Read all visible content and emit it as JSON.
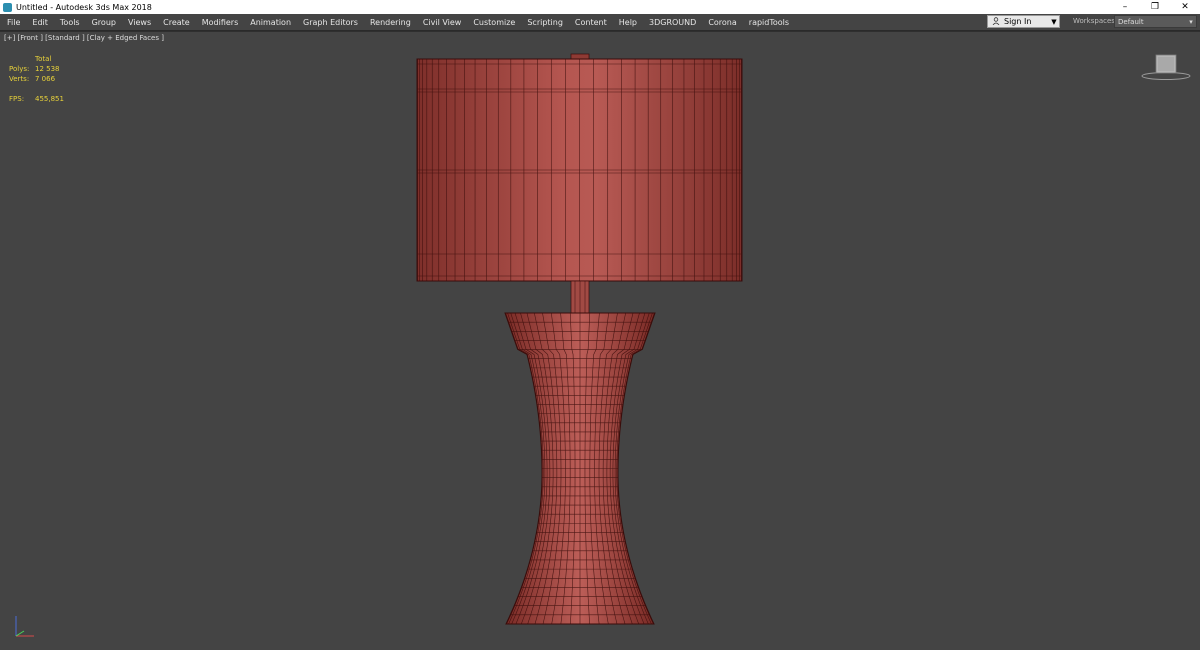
{
  "window": {
    "title": "Untitled - Autodesk 3ds Max 2018",
    "controls": {
      "minimize": "–",
      "restore": "❐",
      "close": "✕"
    }
  },
  "menubar": {
    "items": [
      "File",
      "Edit",
      "Tools",
      "Group",
      "Views",
      "Create",
      "Modifiers",
      "Animation",
      "Graph Editors",
      "Rendering",
      "Civil View",
      "Customize",
      "Scripting",
      "Content",
      "Help",
      "3DGROUND",
      "Corona",
      "rapidTools"
    ]
  },
  "account": {
    "signin_label": "Sign In",
    "dropdown_glyph": "▼"
  },
  "workspaces": {
    "label": "Workspaces:",
    "value": "Default",
    "dropdown_glyph": "▾"
  },
  "viewport": {
    "label": "[+] [Front ] [Standard ] [Clay + Edged Faces ]",
    "stats": {
      "header": "Total",
      "polys_label": "Polys:",
      "polys_value": "12 538",
      "verts_label": "Verts:",
      "verts_value": "7 066",
      "fps_label": "FPS:",
      "fps_value": "455,851"
    },
    "mesh_color": "#a8473f",
    "wire_color": "#3a0d0b",
    "background_color": "#444444"
  }
}
